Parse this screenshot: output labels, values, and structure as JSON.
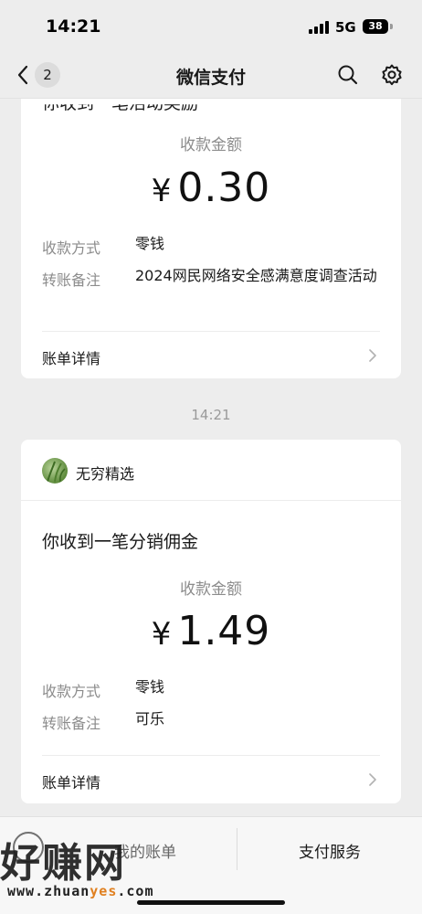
{
  "status_bar": {
    "time": "14:21",
    "network": "5G",
    "battery": "38"
  },
  "nav": {
    "back_badge": "2",
    "title": "微信支付"
  },
  "message_top": {
    "partial_headline": "你收到一笔活动奖励",
    "amount_label": "收款金额",
    "currency": "¥",
    "amount": "0.30",
    "method_label": "收款方式",
    "method_value": "零钱",
    "note_label": "转账备注",
    "note_value": "2024网民网络安全感满意度调查活动",
    "detail_label": "账单详情"
  },
  "timestamp": "14:21",
  "message_bottom": {
    "merchant": "无穷精选",
    "headline": "你收到一笔分销佣金",
    "amount_label": "收款金额",
    "currency": "¥",
    "amount": "1.49",
    "method_label": "收款方式",
    "method_value": "零钱",
    "note_label": "转账备注",
    "note_value": "可乐",
    "detail_label": "账单详情"
  },
  "bottom_bar": {
    "left_tab": "我的账单",
    "right_tab": "支付服务"
  },
  "watermark": {
    "text": "好赚网",
    "url_prefix": "www.zhuan",
    "url_highlight": "yes",
    "url_suffix": ".com"
  },
  "colors": {
    "background": "#ededed",
    "card": "#ffffff",
    "secondary_text": "#8c8c8c"
  }
}
